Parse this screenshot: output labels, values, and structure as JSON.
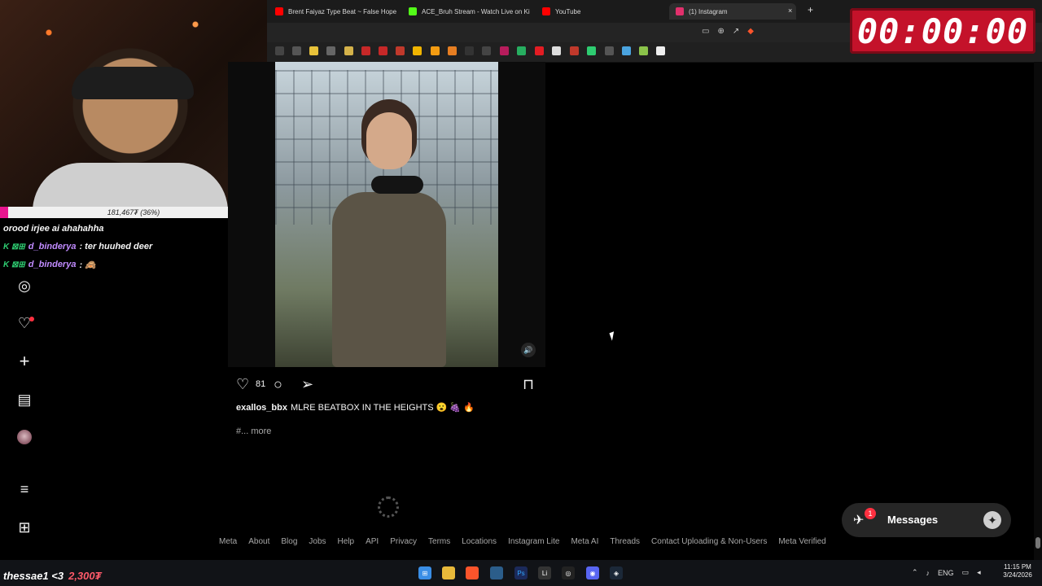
{
  "browser": {
    "tabs": [
      {
        "label": "Brent Faiyaz Type Beat ~ False Hope",
        "icon": "youtube-icon",
        "color": "#ff0000"
      },
      {
        "label": "ACE_Bruh Stream - Watch Live on Ki",
        "icon": "kick-icon",
        "color": "#53fc18"
      },
      {
        "label": "YouTube",
        "icon": "youtube-icon",
        "color": "#ff0000"
      },
      {
        "label": "(1) Instagram",
        "icon": "instagram-icon",
        "color": "#e1306c"
      }
    ],
    "close_glyph": "×",
    "new_tab_glyph": "+"
  },
  "timer": {
    "display": "00:00:00"
  },
  "stream": {
    "points_text": "181,467₮ (36%)",
    "points_fraction": 0.03,
    "chat": [
      {
        "user": "",
        "badges": "",
        "message": "orood irjee ai ahahahha"
      },
      {
        "user": "d_binderya",
        "badges": "K ⊠⊞",
        "message": ": ter huuhed deer"
      },
      {
        "user": "d_binderya",
        "badges": "K ⊠⊞",
        "message": ": 🙈"
      }
    ],
    "bottom_user": "thessae1 <3",
    "bottom_amount": "2,300₮"
  },
  "sidebar": {
    "icons": [
      "compass-icon",
      "heart-icon",
      "plus-icon",
      "stats-icon",
      "avatar",
      "menu-icon",
      "grid-icon"
    ]
  },
  "post": {
    "likes": "81",
    "username": "exallos_bbx",
    "caption": "MLRE BEATBOX IN THE HEIGHTS 😮 🍇 🔥",
    "more_prefix": "#...",
    "more_label": "more"
  },
  "footer": {
    "links": [
      "Meta",
      "About",
      "Blog",
      "Jobs",
      "Help",
      "API",
      "Privacy",
      "Terms",
      "Locations",
      "Instagram Lite",
      "Meta AI",
      "Threads",
      "Contact Uploading & Non-Users",
      "Meta Verified"
    ]
  },
  "messages": {
    "label": "Messages",
    "badge": "1"
  },
  "taskbar": {
    "lang": "ENG",
    "time": "11:15 PM",
    "date": "3/24/2026"
  }
}
